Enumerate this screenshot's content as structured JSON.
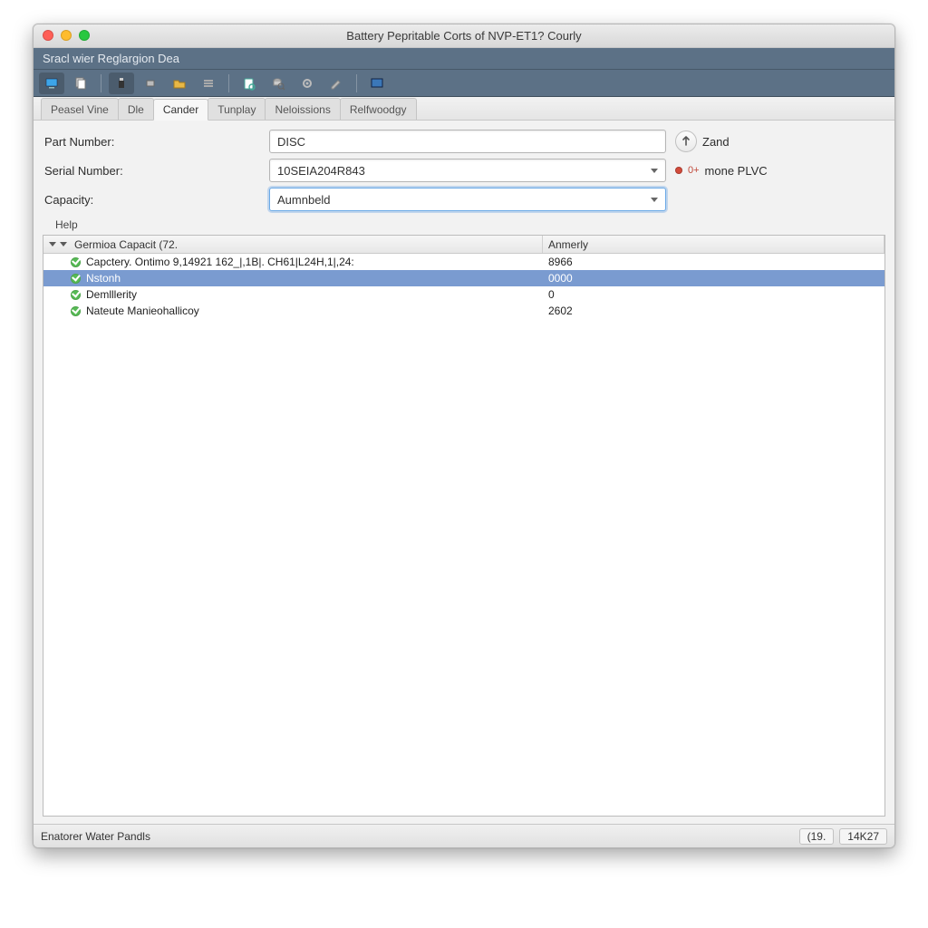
{
  "window": {
    "title": "Battery Pepritable Corts of NVP-ET1?  Courly"
  },
  "subheader": {
    "text": "Sracl wier Reglargion Dea"
  },
  "tabs": [
    {
      "label": "Peasel Vine",
      "active": false
    },
    {
      "label": "Dle",
      "active": false
    },
    {
      "label": "Cander",
      "active": true
    },
    {
      "label": "Tunplay",
      "active": false
    },
    {
      "label": "Neloissions",
      "active": false
    },
    {
      "label": "Relfwoodgy",
      "active": false
    }
  ],
  "form": {
    "part_label": "Part Number:",
    "part_value": "DISC",
    "serial_label": "Serial Number:",
    "serial_value": "10SEIA204R843",
    "capacity_label": "Capacity:",
    "capacity_value": "Aumnbeld",
    "zand_label": "Zand",
    "mone_label": "mone PLVC",
    "help_label": "Help"
  },
  "table": {
    "headers": {
      "name": "Germioa Capacit (72.",
      "value": "Anmerly"
    },
    "rows": [
      {
        "name": "Capctery. Ontimo 9,14921 162_|,1B|. CH61|L24H,1|,24:",
        "value": "8966",
        "selected": false
      },
      {
        "name": "Nstonh",
        "value": "0000",
        "selected": true
      },
      {
        "name": "Demlllerity",
        "value": "0",
        "selected": false
      },
      {
        "name": "Nateute Manieohallicoy",
        "value": "2602",
        "selected": false
      }
    ]
  },
  "status": {
    "left": "Enatorer Water Pandls",
    "right1": "(19.",
    "right2": "14K27"
  }
}
